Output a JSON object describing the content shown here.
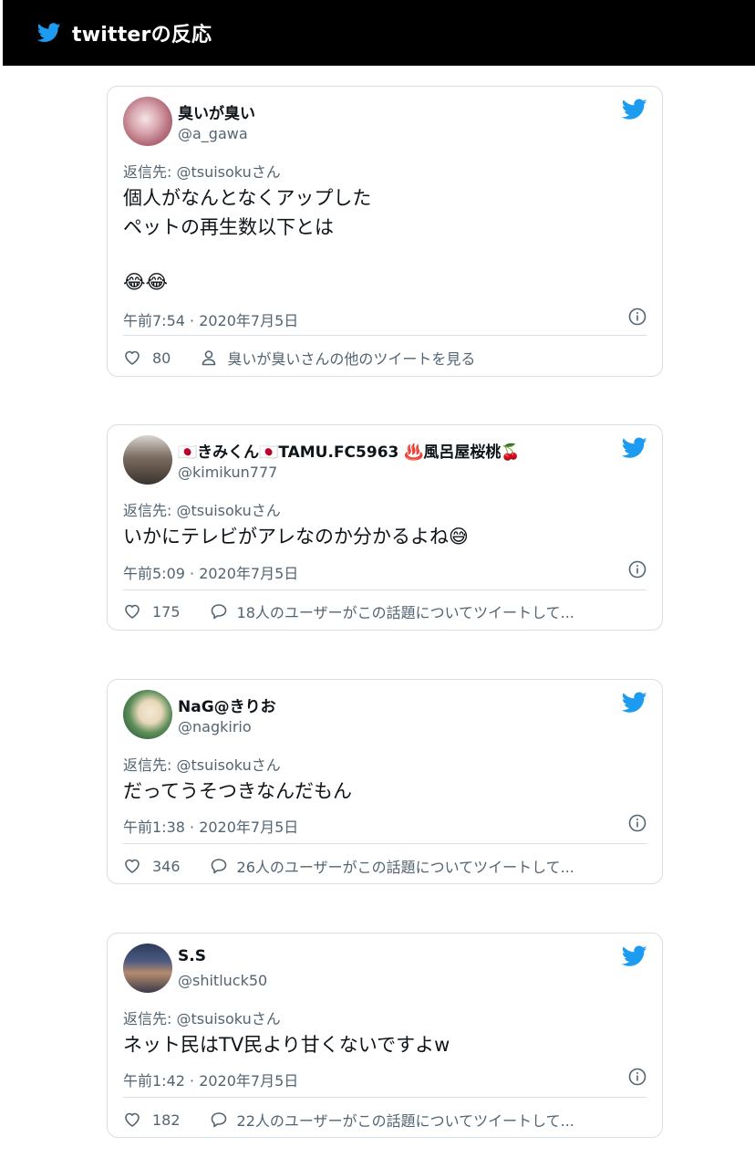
{
  "header": {
    "title": "twitterの反応"
  },
  "colors": {
    "twitter_blue": "#1d9bf0",
    "header_bg": "#000000",
    "muted": "#536471"
  },
  "tweets": [
    {
      "display_name": "臭いが臭い",
      "handle": "@a_gawa",
      "reply_to": "返信先: @tsuisokuさん",
      "text": "個人がなんとなくアップした\nペットの再生数以下とは",
      "emoji": "😂😂",
      "timestamp": "午前7:54 · 2020年7月5日",
      "likes": "80",
      "more_text": "臭いが臭いさんの他のツイートを見る",
      "more_icon": "person-icon"
    },
    {
      "display_name": "🇯🇵きみくん🇯🇵TAMU.FC5963 ♨️風呂屋桜桃🍒",
      "handle": "@kimikun777",
      "reply_to": "返信先: @tsuisokuさん",
      "text": "いかにテレビがアレなのか分かるよね😅",
      "timestamp": "午前5:09 · 2020年7月5日",
      "likes": "175",
      "more_text": "18人のユーザーがこの話題についてツイートして...",
      "more_icon": "comment-icon"
    },
    {
      "display_name": "NaG@きりお",
      "handle": "@nagkirio",
      "reply_to": "返信先: @tsuisokuさん",
      "text": "だってうそつきなんだもん",
      "timestamp": "午前1:38 · 2020年7月5日",
      "likes": "346",
      "more_text": "26人のユーザーがこの話題についてツイートして...",
      "more_icon": "comment-icon"
    },
    {
      "display_name": "S.S",
      "handle": "@shitluck50",
      "reply_to": "返信先: @tsuisokuさん",
      "text": "ネット民はTV民より甘くないですよw",
      "timestamp": "午前1:42 · 2020年7月5日",
      "likes": "182",
      "more_text": "22人のユーザーがこの話題についてツイートして...",
      "more_icon": "comment-icon"
    }
  ]
}
